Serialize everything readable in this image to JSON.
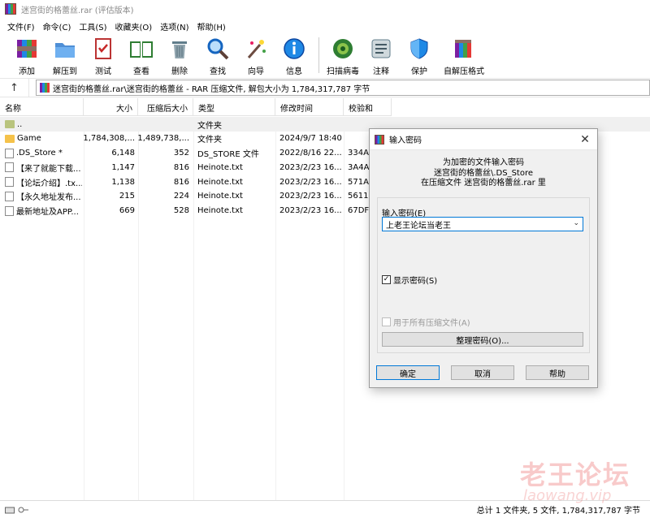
{
  "window": {
    "title": "迷宫街的格蕾丝.rar (评估版本)"
  },
  "menu": [
    "文件(F)",
    "命令(C)",
    "工具(S)",
    "收藏夹(O)",
    "选项(N)",
    "帮助(H)"
  ],
  "toolbar": [
    {
      "label": "添加",
      "icon": "add-archive-icon"
    },
    {
      "label": "解压到",
      "icon": "extract-to-icon"
    },
    {
      "label": "测试",
      "icon": "test-icon"
    },
    {
      "label": "查看",
      "icon": "view-book-icon"
    },
    {
      "label": "删除",
      "icon": "trash-icon"
    },
    {
      "label": "查找",
      "icon": "magnifier-icon"
    },
    {
      "label": "向导",
      "icon": "wizard-icon"
    },
    {
      "label": "信息",
      "icon": "info-icon"
    },
    {
      "label": "扫描病毒",
      "icon": "virus-scan-icon"
    },
    {
      "label": "注释",
      "icon": "comment-icon"
    },
    {
      "label": "保护",
      "icon": "shield-icon"
    },
    {
      "label": "自解压格式",
      "icon": "sfx-icon"
    }
  ],
  "address": {
    "up_label": "↑",
    "path": "迷宫街的格蕾丝.rar\\迷宫街的格蕾丝 - RAR 压缩文件, 解包大小为 1,784,317,787 字节"
  },
  "columns": [
    "名称",
    "大小",
    "压缩后大小",
    "类型",
    "修改时间",
    "校验和"
  ],
  "files": [
    {
      "name": "..",
      "size": "",
      "packed": "",
      "type": "文件夹",
      "modified": "",
      "crc": "",
      "kind": "up"
    },
    {
      "name": "Game",
      "size": "1,784,308,...",
      "packed": "1,489,738,...",
      "type": "文件夹",
      "modified": "2024/9/7 18:40",
      "crc": "",
      "kind": "folder"
    },
    {
      "name": ".DS_Store *",
      "size": "6,148",
      "packed": "352",
      "type": "DS_STORE 文件",
      "modified": "2022/8/16 22...",
      "crc": "334A",
      "kind": "file"
    },
    {
      "name": "【来了就能下载...",
      "size": "1,147",
      "packed": "816",
      "type": "Heinote.txt",
      "modified": "2023/2/23 16...",
      "crc": "3A4A",
      "kind": "file"
    },
    {
      "name": "【论坛介绍】.tx...",
      "size": "1,138",
      "packed": "816",
      "type": "Heinote.txt",
      "modified": "2023/2/23 16...",
      "crc": "571A",
      "kind": "file"
    },
    {
      "name": "【永久地址发布...",
      "size": "215",
      "packed": "224",
      "type": "Heinote.txt",
      "modified": "2023/2/23 16...",
      "crc": "5611",
      "kind": "file"
    },
    {
      "name": "最新地址及APP...",
      "size": "669",
      "packed": "528",
      "type": "Heinote.txt",
      "modified": "2023/2/23 16...",
      "crc": "67DF",
      "kind": "file"
    }
  ],
  "status": {
    "summary": "总计 1 文件夹, 5 文件, 1,784,317,787 字节"
  },
  "watermark": {
    "line1": "老王论坛",
    "line2": "laowang.vip"
  },
  "dialog": {
    "title": "输入密码",
    "close": "✕",
    "message_lines": [
      "为加密的文件输入密码",
      "迷宫街的格蕾丝\\.DS_Store",
      "在压缩文件 迷宫街的格蕾丝.rar 里"
    ],
    "password_label": "输入密码(E)",
    "password_value": "上老王论坛当老王",
    "show_password_label": "显示密码(S)",
    "show_password_checked": true,
    "use_all_label": "用于所有压缩文件(A)",
    "use_all_checked": false,
    "organize_button": "整理密码(O)...",
    "ok_button": "确定",
    "cancel_button": "取消",
    "help_button": "帮助"
  },
  "colors": {
    "accent": "#0078d7",
    "dialog_bg": "#f0f0f0",
    "folder": "#f5c24a"
  }
}
